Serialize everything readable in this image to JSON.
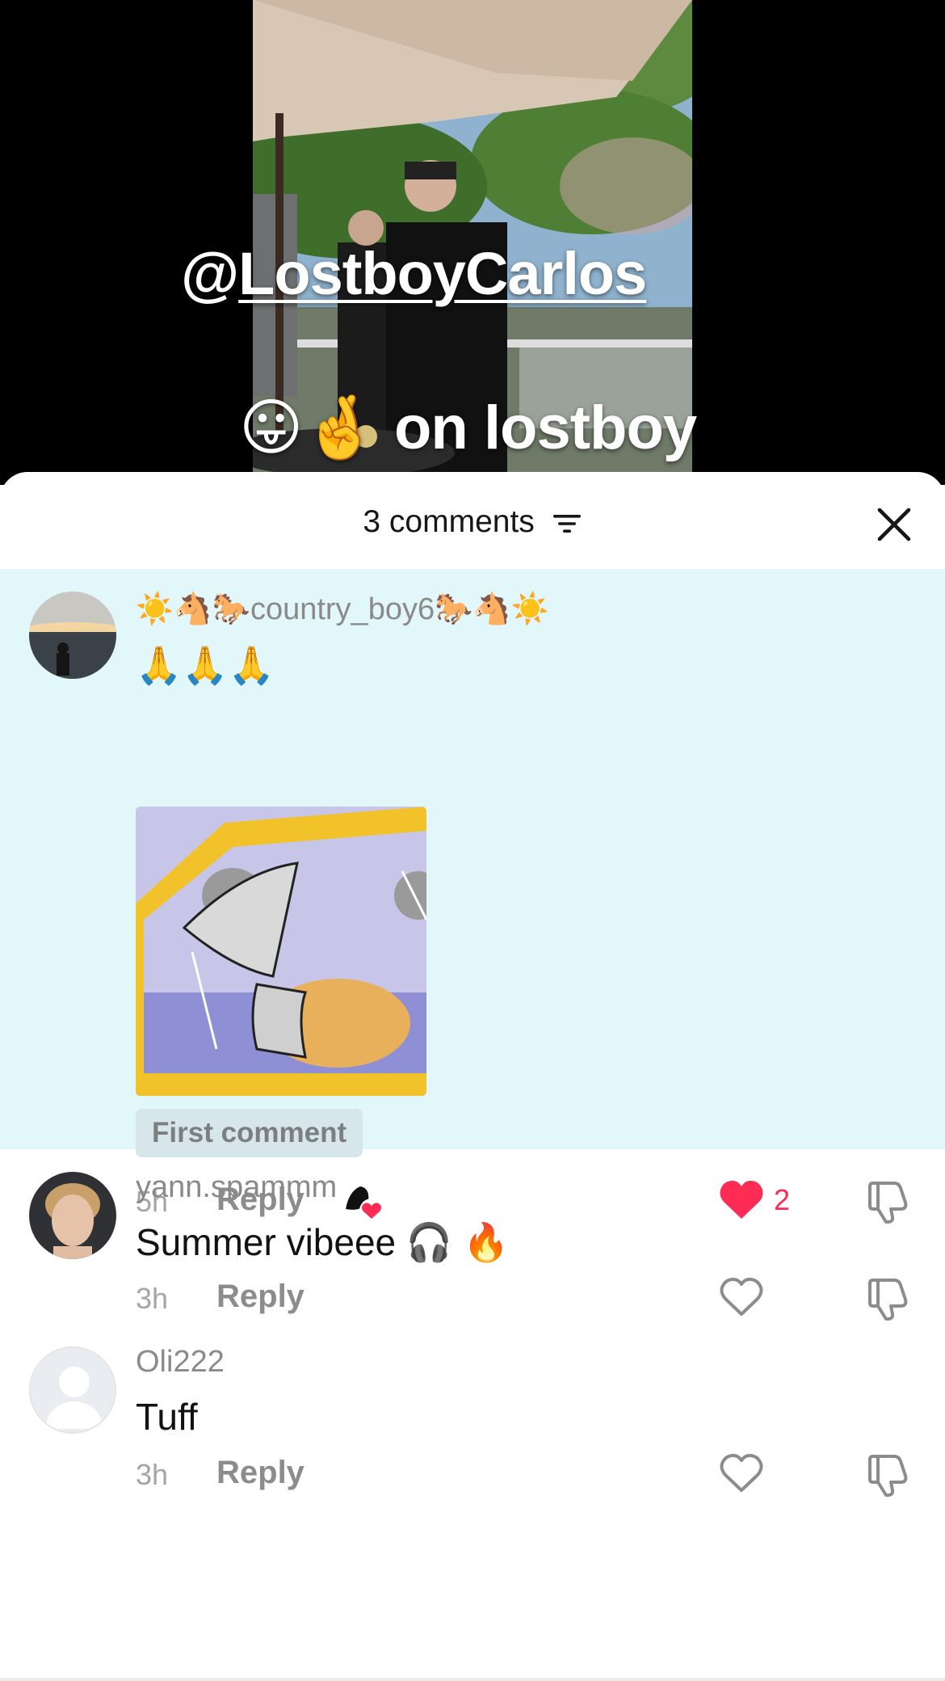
{
  "video": {
    "mention_prefix": "@",
    "mention_handle": "LostboyCarlos",
    "caption_emoji": "😛🤞",
    "caption_text": " on lostboy"
  },
  "sheet": {
    "comment_count_label": "3 comments",
    "icons": {
      "filter": "filter-lines-icon",
      "close": "close-x-icon"
    }
  },
  "comments": [
    {
      "username": "☀️🐴🐎country_boy6🐎🐴☀️",
      "text": "🙏🙏🙏",
      "has_sticker": true,
      "badge": "First comment",
      "time": "5h",
      "reply_label": "Reply",
      "liked_by_creator": true,
      "liked": true,
      "like_count": "2",
      "highlight_color": "#e2f7fa"
    },
    {
      "username": "yann.spammm",
      "text": "Summer vibeee 🎧 🔥",
      "time": "3h",
      "reply_label": "Reply",
      "liked": false,
      "like_count": ""
    },
    {
      "username": "Oli222",
      "text": "Tuff",
      "time": "3h",
      "reply_label": "Reply",
      "liked": false,
      "like_count": ""
    }
  ],
  "colors": {
    "like_red": "#fe2c55",
    "meta_gray": "#a5a5a5"
  }
}
